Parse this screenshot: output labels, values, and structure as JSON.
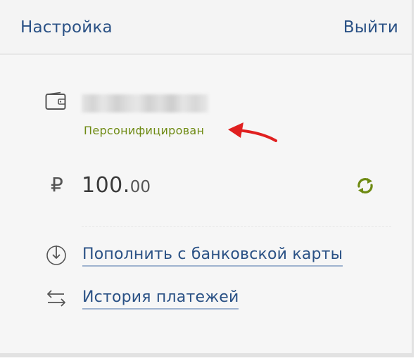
{
  "header": {
    "settings_label": "Настройка",
    "logout_label": "Выйти"
  },
  "account": {
    "status_label": "Персонифицирован",
    "status_color": "#6e8a12"
  },
  "balance": {
    "currency_symbol": "₽",
    "amount_integer": "100.",
    "amount_fraction": "00"
  },
  "actions": {
    "topup_label": "Пополнить с банковской карты",
    "history_label": "История платежей"
  },
  "colors": {
    "link": "#2a5185",
    "accent_green": "#6e8a12",
    "annotation_arrow": "#e02020"
  },
  "icons": {
    "wallet": "wallet-icon",
    "ruble": "ruble-icon",
    "refresh": "refresh-icon",
    "topup": "download-circle-icon",
    "history": "swap-arrows-icon",
    "annotation": "red-arrow-icon"
  }
}
